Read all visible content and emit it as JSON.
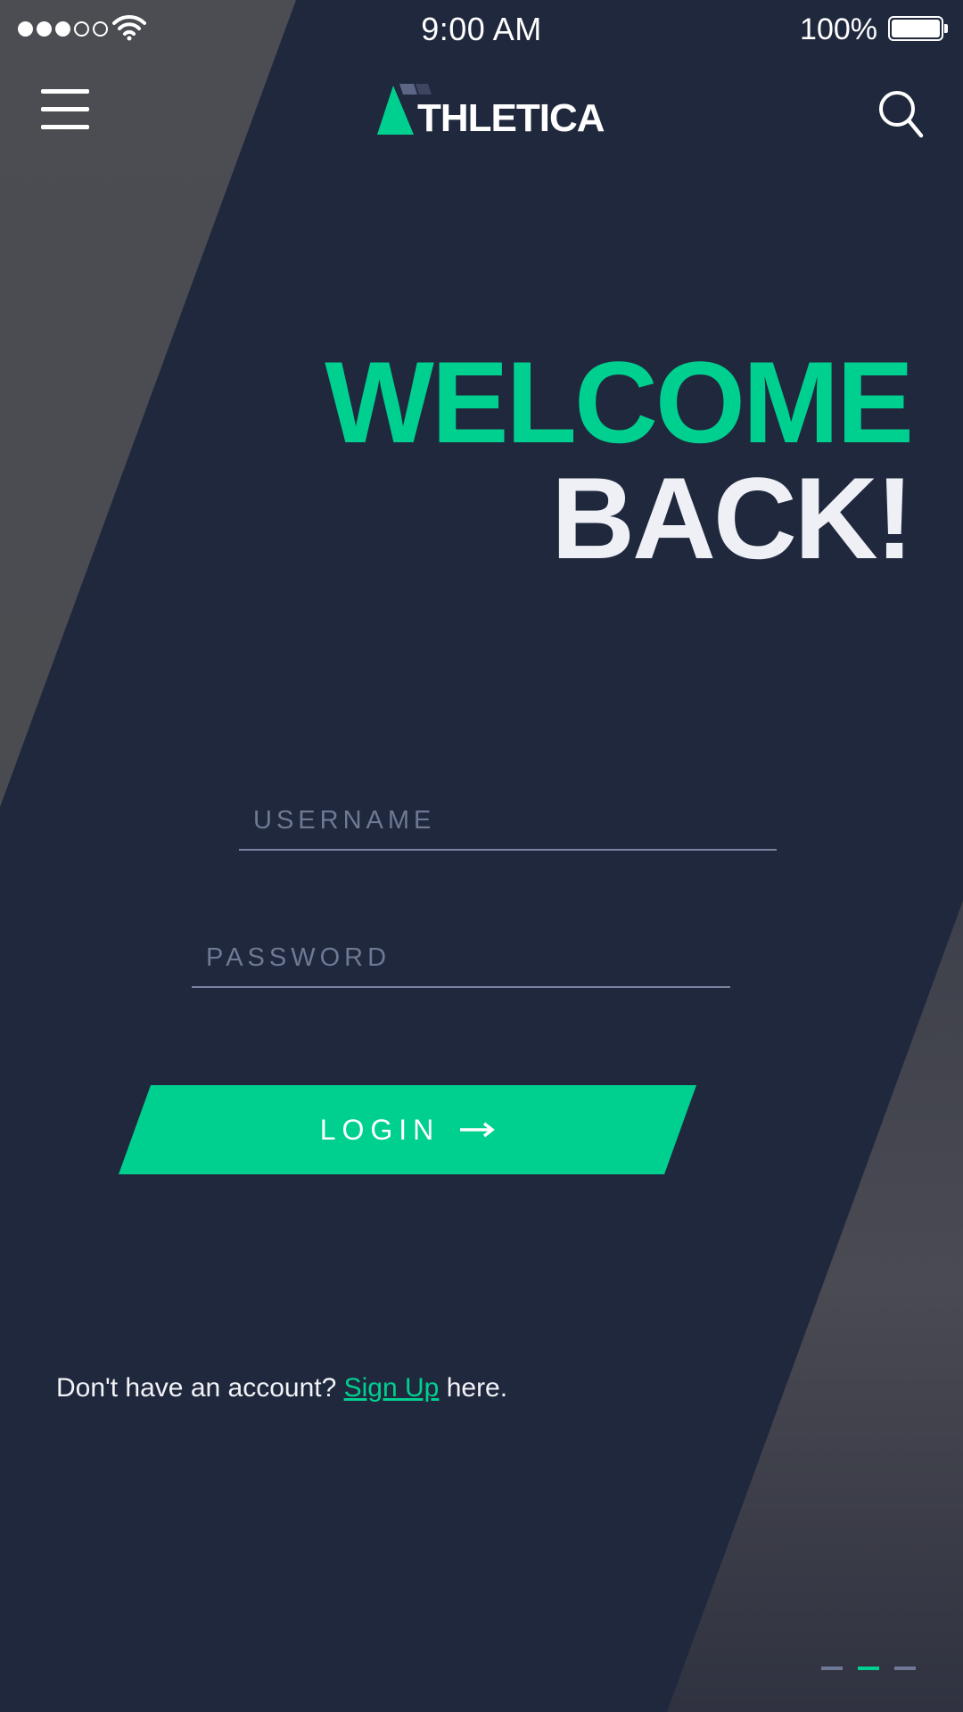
{
  "status_bar": {
    "time": "9:00 AM",
    "battery": "100%",
    "signal_bars_filled": 3,
    "signal_bars_total": 5
  },
  "header": {
    "menu_icon": "hamburger-icon",
    "logo_text": "THLETICA",
    "search_icon": "search-icon"
  },
  "hero": {
    "line1": "WELCOME",
    "line2": "BACK!"
  },
  "form": {
    "username_placeholder": "USERNAME",
    "password_placeholder": "PASSWORD",
    "login_label": "LOGIN",
    "login_icon": "arrow-right-icon"
  },
  "signup": {
    "prefix": "Don't have an account? ",
    "link": "Sign Up",
    "suffix": " here."
  },
  "pager": {
    "count": 3,
    "active_index": 1
  },
  "colors": {
    "accent": "#00d08f",
    "background": "#20283d",
    "headline_white": "#eef0f6",
    "placeholder": "#6f7894"
  }
}
